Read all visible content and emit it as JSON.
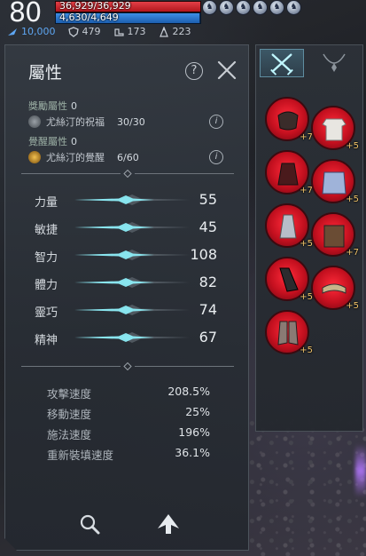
{
  "hud": {
    "level": "80",
    "hp_text": "36,929/36,929",
    "hp_fraction": 1.0,
    "mp_text": "4,630/4,649",
    "mp_fraction": 0.996,
    "currency_value": "10,000",
    "defense_value": "479",
    "speed_stat_value": "173",
    "other_stat_value": "223",
    "buffs": [
      "buff-1",
      "buff-2",
      "buff-3",
      "buff-4",
      "buff-5",
      "buff-6"
    ]
  },
  "attribute_panel": {
    "title": "屬性",
    "help_label": "?",
    "reward_attr": {
      "label": "獎勵屬性",
      "value": "0",
      "blessing_name": "尤絲汀的祝福",
      "blessing_count": "30/30"
    },
    "awaken_attr": {
      "label": "覺醒屬性",
      "value": "0",
      "awaken_name": "尤絲汀的覺醒",
      "awaken_count": "6/60"
    },
    "info_label": "i",
    "attributes": [
      {
        "name": "力量",
        "value": "55"
      },
      {
        "name": "敏捷",
        "value": "45"
      },
      {
        "name": "智力",
        "value": "108"
      },
      {
        "name": "體力",
        "value": "82"
      },
      {
        "name": "靈巧",
        "value": "74"
      },
      {
        "name": "精神",
        "value": "67"
      }
    ],
    "speeds": [
      {
        "label": "攻擊速度",
        "value": "208.5%"
      },
      {
        "label": "移動速度",
        "value": "25%"
      },
      {
        "label": "施法速度",
        "value": "196%"
      },
      {
        "label": "重新裝填速度",
        "value": "36.1%"
      }
    ]
  },
  "equipment": {
    "tabs": [
      "swords-icon",
      "necklace-icon"
    ],
    "slots": [
      {
        "name": "chest-armor-slot",
        "enhance": "+7"
      },
      {
        "name": "shirt-slot",
        "enhance": "+5"
      },
      {
        "name": "cape-slot",
        "enhance": "+7"
      },
      {
        "name": "skirt-slot",
        "enhance": "+5"
      },
      {
        "name": "bracer-slot",
        "enhance": "+5"
      },
      {
        "name": "spellbook-slot",
        "enhance": "+7"
      },
      {
        "name": "gauntlet-slot",
        "enhance": "+5"
      },
      {
        "name": "belt-slot",
        "enhance": "+5"
      },
      {
        "name": "boots-slot",
        "enhance": "+5"
      }
    ]
  },
  "colors": {
    "hp": "#d8262f",
    "mp": "#2f7fd6",
    "glow": "#8ff5ff",
    "slot_red": "#e0182a",
    "enhance": "#f0c36a"
  }
}
